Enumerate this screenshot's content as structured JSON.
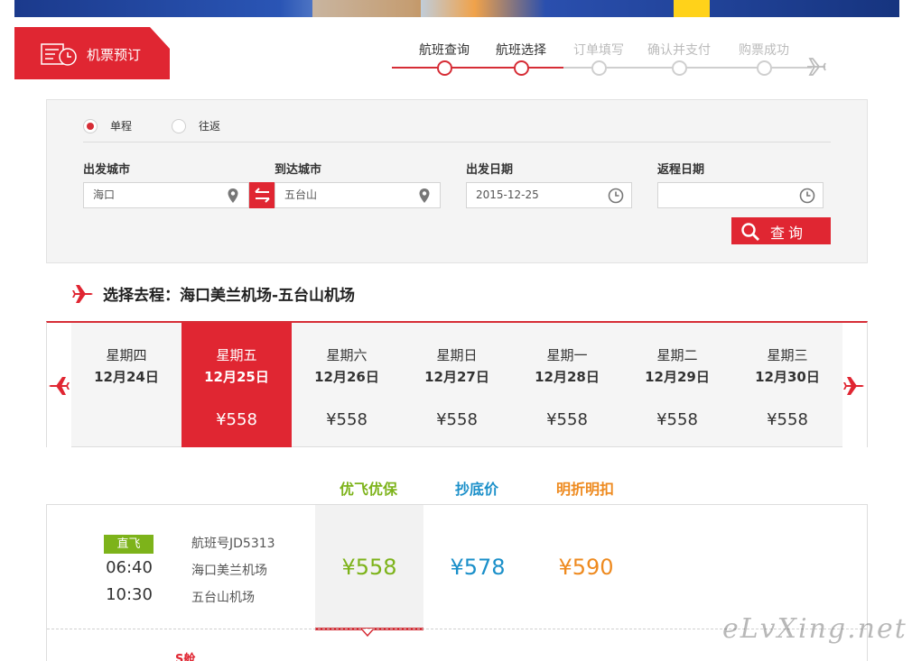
{
  "header": {
    "tag_label": "机票预订"
  },
  "steps": [
    {
      "label": "航班查询",
      "state": "done"
    },
    {
      "label": "航班选择",
      "state": "done"
    },
    {
      "label": "订单填写",
      "state": "todo"
    },
    {
      "label": "确认并支付",
      "state": "todo"
    },
    {
      "label": "购票成功",
      "state": "todo"
    }
  ],
  "search": {
    "trip_types": [
      {
        "label": "单程",
        "selected": true
      },
      {
        "label": "往返",
        "selected": false
      }
    ],
    "depart_city_label": "出发城市",
    "depart_city_value": "海口",
    "arrive_city_label": "到达城市",
    "arrive_city_value": "五台山",
    "depart_date_label": "出发日期",
    "depart_date_value": "2015-12-25",
    "return_date_label": "返程日期",
    "return_date_value": "",
    "search_button": "查询"
  },
  "route_heading": "选择去程：海口美兰机场-五台山机场",
  "days": [
    {
      "weekday": "星期四",
      "date": "12月24日",
      "price": "",
      "active": false
    },
    {
      "weekday": "星期五",
      "date": "12月25日",
      "price": "¥558",
      "active": true
    },
    {
      "weekday": "星期六",
      "date": "12月26日",
      "price": "¥558",
      "active": false
    },
    {
      "weekday": "星期日",
      "date": "12月27日",
      "price": "¥558",
      "active": false
    },
    {
      "weekday": "星期一",
      "date": "12月28日",
      "price": "¥558",
      "active": false
    },
    {
      "weekday": "星期二",
      "date": "12月29日",
      "price": "¥558",
      "active": false
    },
    {
      "weekday": "星期三",
      "date": "12月30日",
      "price": "¥558",
      "active": false
    }
  ],
  "fare_columns": [
    {
      "label": "优飞优保",
      "color": "#7db31a"
    },
    {
      "label": "抄底价",
      "color": "#1a8fc9"
    },
    {
      "label": "明折明扣",
      "color": "#ee8a1f"
    }
  ],
  "flight": {
    "badge": "直飞",
    "depart_time": "06:40",
    "arrive_time": "10:30",
    "flight_no": "航班号JD5313",
    "depart_airport": "海口美兰机场",
    "arrive_airport": "五台山机场",
    "prices": [
      "¥558",
      "¥578",
      "¥590"
    ],
    "cabin": "S舱"
  },
  "watermark": "eLvXing.net",
  "colors": {
    "accent": "#e02632",
    "green": "#7db31a",
    "blue": "#1a8fc9",
    "orange": "#ee8a1f"
  }
}
